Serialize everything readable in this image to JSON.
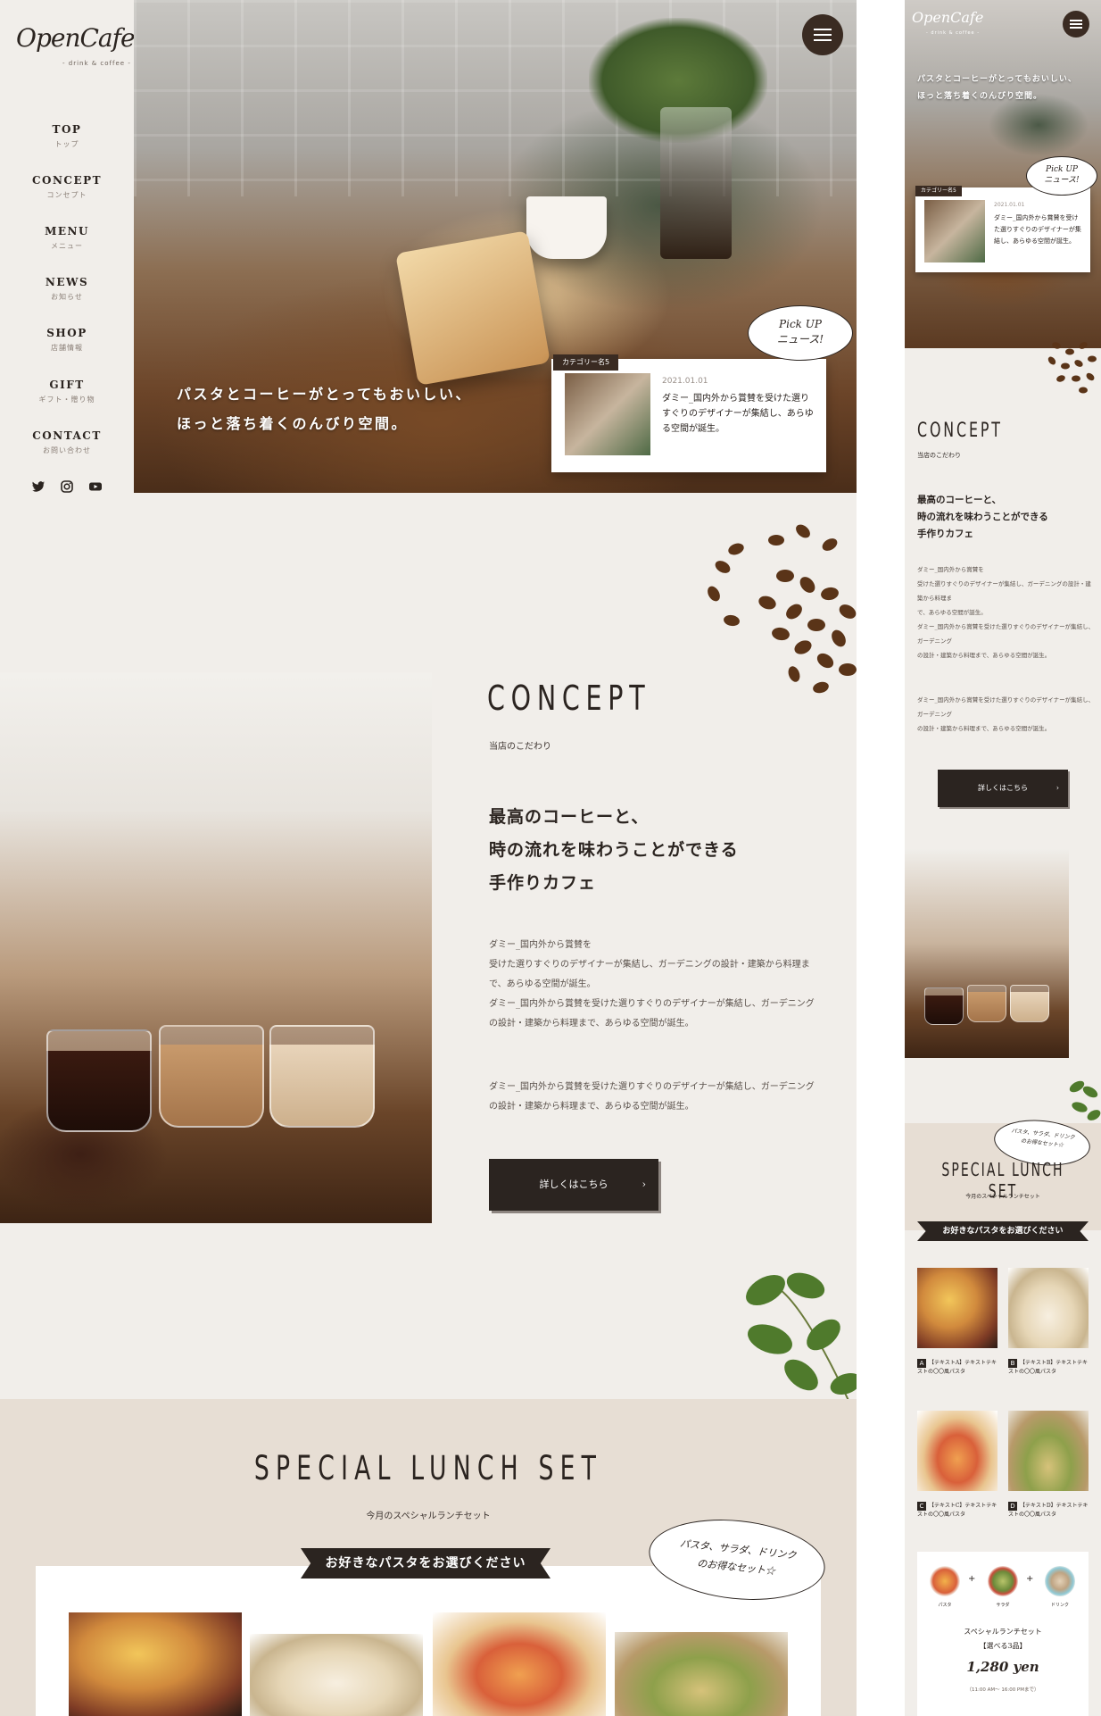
{
  "brand": {
    "logo": "OpenCafe",
    "tagline": "- drink & coffee -"
  },
  "nav": [
    {
      "en": "TOP",
      "jp": "トップ"
    },
    {
      "en": "CONCEPT",
      "jp": "コンセプト"
    },
    {
      "en": "MENU",
      "jp": "メニュー"
    },
    {
      "en": "NEWS",
      "jp": "お知らせ"
    },
    {
      "en": "SHOP",
      "jp": "店舗情報"
    },
    {
      "en": "GIFT",
      "jp": "ギフト・贈り物"
    },
    {
      "en": "CONTACT",
      "jp": "お問い合わせ"
    }
  ],
  "social": [
    "twitter-icon",
    "instagram-icon",
    "youtube-icon"
  ],
  "hero": {
    "catch": "パスタとコーヒーがとってもおいしい、\nほっと落ち着くのんびり空間。"
  },
  "pickup": {
    "bubble": "Pick UP\nニュース!",
    "category": "カテゴリー名5",
    "date": "2021.01.01",
    "text": "ダミー_国内外から賞賛を受けた選りすぐりのデザイナーが集結し、あらゆる空間が誕生。"
  },
  "concept": {
    "title_en": "CONCEPT",
    "title_jp": "当店のこだわり",
    "lead": "最高のコーヒーと、\n時の流れを味わうことができる\n手作りカフェ",
    "para1": "ダミー_国内外から賞賛を\n受けた選りすぐりのデザイナーが集結し、ガーデニングの設計・建築から料理ま\nで、あらゆる空間が誕生。\nダミー_国内外から賞賛を受けた選りすぐりのデザイナーが集結し、ガーデニング\nの設計・建築から料理まで、あらゆる空間が誕生。",
    "para2": "ダミー_国内外から賞賛を受けた選りすぐりのデザイナーが集結し、ガーデニング\nの設計・建築から料理まで、あらゆる空間が誕生。",
    "button": "詳しくはこちら"
  },
  "lunch": {
    "title_en": "SPECIAL LUNCH SET",
    "title_jp": "今月のスペシャルランチセット",
    "ribbon": "お好きなパスタをお選びください",
    "bubble": "パスタ、サラダ、ドリンク\nのお得なセット☆"
  },
  "mobile": {
    "date": "2021.01.01",
    "pastas": [
      {
        "letter": "A",
        "label": "【テキストA】テキストテキストの〇〇風パスタ"
      },
      {
        "letter": "B",
        "label": "【テキストB】テキストテキストの〇〇風パスタ"
      },
      {
        "letter": "C",
        "label": "【テキストC】テキストテキストの〇〇風パスタ"
      },
      {
        "letter": "D",
        "label": "【テキストD】テキストテキストの〇〇風パスタ"
      }
    ],
    "set_items": [
      "パスタ",
      "サラダ",
      "ドリンク"
    ],
    "set_title": "スペシャルランチセット\n【選べる3品】",
    "set_price": "1,280 yen",
    "set_time": "（11:00 AM〜 16:00 PMまで）"
  },
  "colors": {
    "background": "#f1eeea",
    "accent_dark": "#2b2420",
    "lunch_bg": "#e7ded4"
  }
}
